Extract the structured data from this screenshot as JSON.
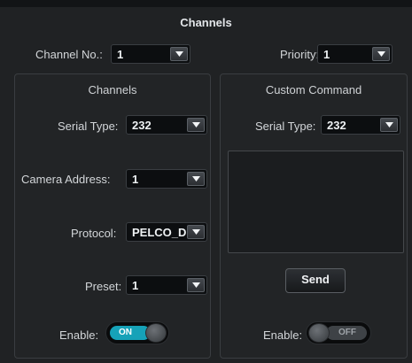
{
  "title": "Channels",
  "header": {
    "channel_no": {
      "label": "Channel No.:",
      "value": "1"
    },
    "priority": {
      "label": "Priority:",
      "value": "1"
    }
  },
  "channels_panel": {
    "title": "Channels",
    "serial_type": {
      "label": "Serial Type:",
      "value": "232"
    },
    "camera_address": {
      "label": "Camera Address:",
      "value": "1"
    },
    "protocol": {
      "label": "Protocol:",
      "value": "PELCO_D"
    },
    "preset": {
      "label": "Preset:",
      "value": "1"
    },
    "enable": {
      "label": "Enable:",
      "state": "ON"
    }
  },
  "custom_panel": {
    "title": "Custom Command",
    "serial_type": {
      "label": "Serial Type:",
      "value": "232"
    },
    "command_text": "",
    "send_label": "Send",
    "enable": {
      "label": "Enable:",
      "state": "OFF"
    }
  },
  "colors": {
    "background": "#202224",
    "toggle_on": "#16a2b8",
    "toggle_off": "#3e4246",
    "select_bg": "#0c0e10"
  },
  "icons": {
    "dropdown": "chevron-down-icon"
  }
}
